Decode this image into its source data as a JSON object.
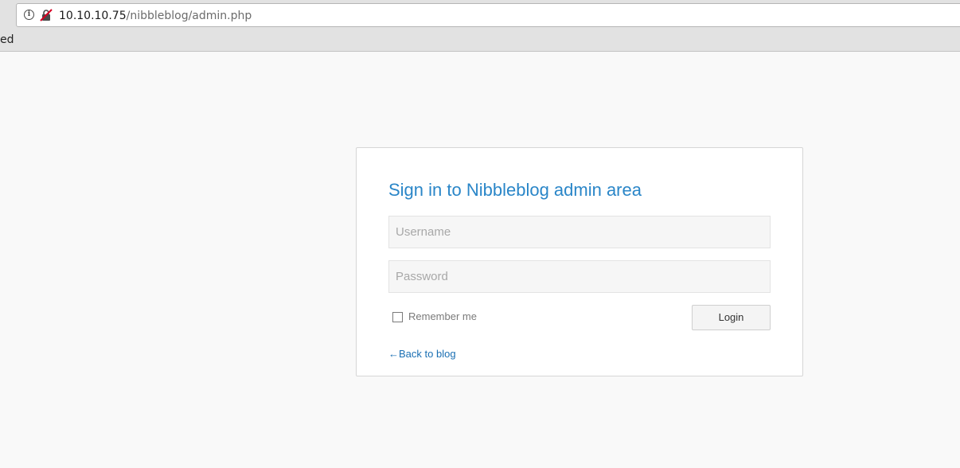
{
  "browser": {
    "url_host": "10.10.10.75",
    "url_path": "/nibbleblog/admin.php",
    "bookmark_partial": "ed",
    "icons": [
      "info-icon",
      "insecure-connection-icon"
    ]
  },
  "login": {
    "title": "Sign in to Nibbleblog admin area",
    "username_placeholder": "Username",
    "password_placeholder": "Password",
    "username_value": "",
    "password_value": "",
    "remember_label": "Remember me",
    "remember_checked": false,
    "login_button": "Login",
    "back_link": "←Back to blog"
  },
  "colors": {
    "accent": "#2a86c8",
    "link": "#1a6fb3",
    "page_background": "#f9f9f9"
  }
}
